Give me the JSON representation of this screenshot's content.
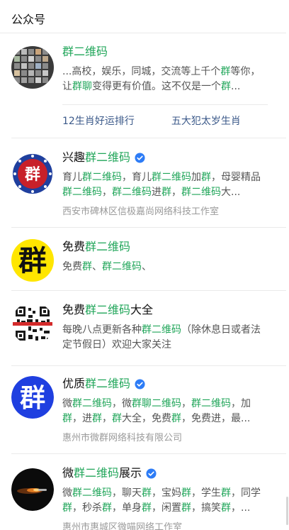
{
  "header": {
    "title": "公众号"
  },
  "accounts": [
    {
      "name_parts": [
        "",
        "群二维码",
        ""
      ],
      "desc_html": "...高校，娱乐，同城，交流等上千个<span class=\"hl\">群</span>等你，让<span class=\"hl\">群聊</span>变得更有价值。这不仅是一个<span class=\"hl\">群</span>...",
      "links": [
        "12生肖好运排行",
        "五大犯太岁生肖"
      ]
    },
    {
      "name_parts": [
        "兴趣",
        "群二维码",
        ""
      ],
      "desc_html": "育儿<span class=\"hl\">群二维码</span>，育儿<span class=\"hl\">群二维码</span>加<span class=\"hl\">群</span>，母婴精品<span class=\"hl\">群二维码</span>，<span class=\"hl\">群二维码</span>进<span class=\"hl\">群</span>，<span class=\"hl\">群二维码</span>大...",
      "org": "西安市碑林区信极嘉尚网络科技工作室"
    },
    {
      "name_parts": [
        "免费",
        "群二维码",
        ""
      ],
      "desc_html": "免费<span class=\"hl\">群</span>、<span class=\"hl\">群二维码</span>、"
    },
    {
      "name_parts": [
        "免费",
        "群二维码",
        "大全"
      ],
      "desc_html": "每晚八点更新各种<span class=\"hl\">群二维码</span>（除休息日或者法定节假日）欢迎大家关注"
    },
    {
      "name_parts": [
        "优质",
        "群二维码",
        ""
      ],
      "desc_html": "微<span class=\"hl\">群二维码</span>，微<span class=\"hl\">群聊二维码</span>，<span class=\"hl\">群二维码</span>，加<span class=\"hl\">群</span>，进<span class=\"hl\">群</span>，<span class=\"hl\">群</span>大全，免费<span class=\"hl\">群</span>，免费进，最...",
      "org": "惠州市微群网络科技有限公司"
    },
    {
      "name_parts": [
        "微",
        "群二维码",
        "展示"
      ],
      "desc_html": "微<span class=\"hl\">群二维码</span>，聊天<span class=\"hl\">群</span>，宝妈<span class=\"hl\">群</span>，学生<span class=\"hl\">群</span>，同学<span class=\"hl\">群</span>，秒杀<span class=\"hl\">群</span>，单身<span class=\"hl\">群</span>，闲置<span class=\"hl\">群</span>，搞笑<span class=\"hl\">群</span>，...",
      "org": "惠州市惠城区微喵网络工作室"
    }
  ],
  "avatar_chars": {
    "a2": "群",
    "a3": "群",
    "a5": "群"
  },
  "colors": {
    "highlight": "#21a65a",
    "link": "#3c5a8a",
    "verified": "#2d7cf6"
  }
}
